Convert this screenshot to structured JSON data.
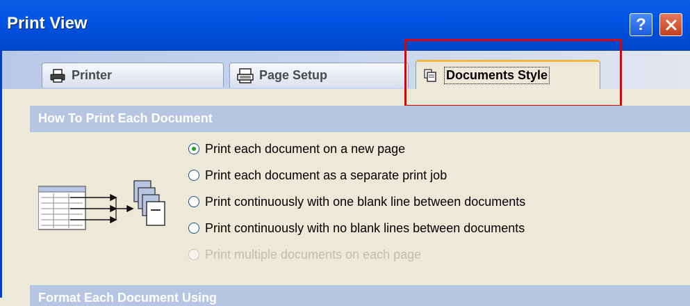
{
  "window": {
    "title": "Print View",
    "help_label": "?",
    "close_label": "✕"
  },
  "tabs": [
    {
      "label": "Printer",
      "icon": "printer-icon",
      "selected": false
    },
    {
      "label": "Page Setup",
      "icon": "page-setup-icon",
      "selected": false
    },
    {
      "label": "Documents Style",
      "icon": "documents-style-icon",
      "selected": true
    }
  ],
  "sections": {
    "how_to_print": {
      "title": "How To Print Each Document",
      "options": [
        {
          "label": "Print each document on a new page",
          "checked": true,
          "enabled": true
        },
        {
          "label": "Print each document as a separate print job",
          "checked": false,
          "enabled": true
        },
        {
          "label": "Print continuously with one blank line between documents",
          "checked": false,
          "enabled": true
        },
        {
          "label": "Print continuously with no blank lines between documents",
          "checked": false,
          "enabled": true
        },
        {
          "label": "Print multiple documents on each page",
          "checked": false,
          "enabled": false
        }
      ]
    },
    "format_each": {
      "title": "Format Each Document Using"
    }
  },
  "colors": {
    "titlebar": "#0054e3",
    "section_bar": "#b6c6e2",
    "highlight": "#e00000",
    "radio_checked": "#21a121"
  }
}
